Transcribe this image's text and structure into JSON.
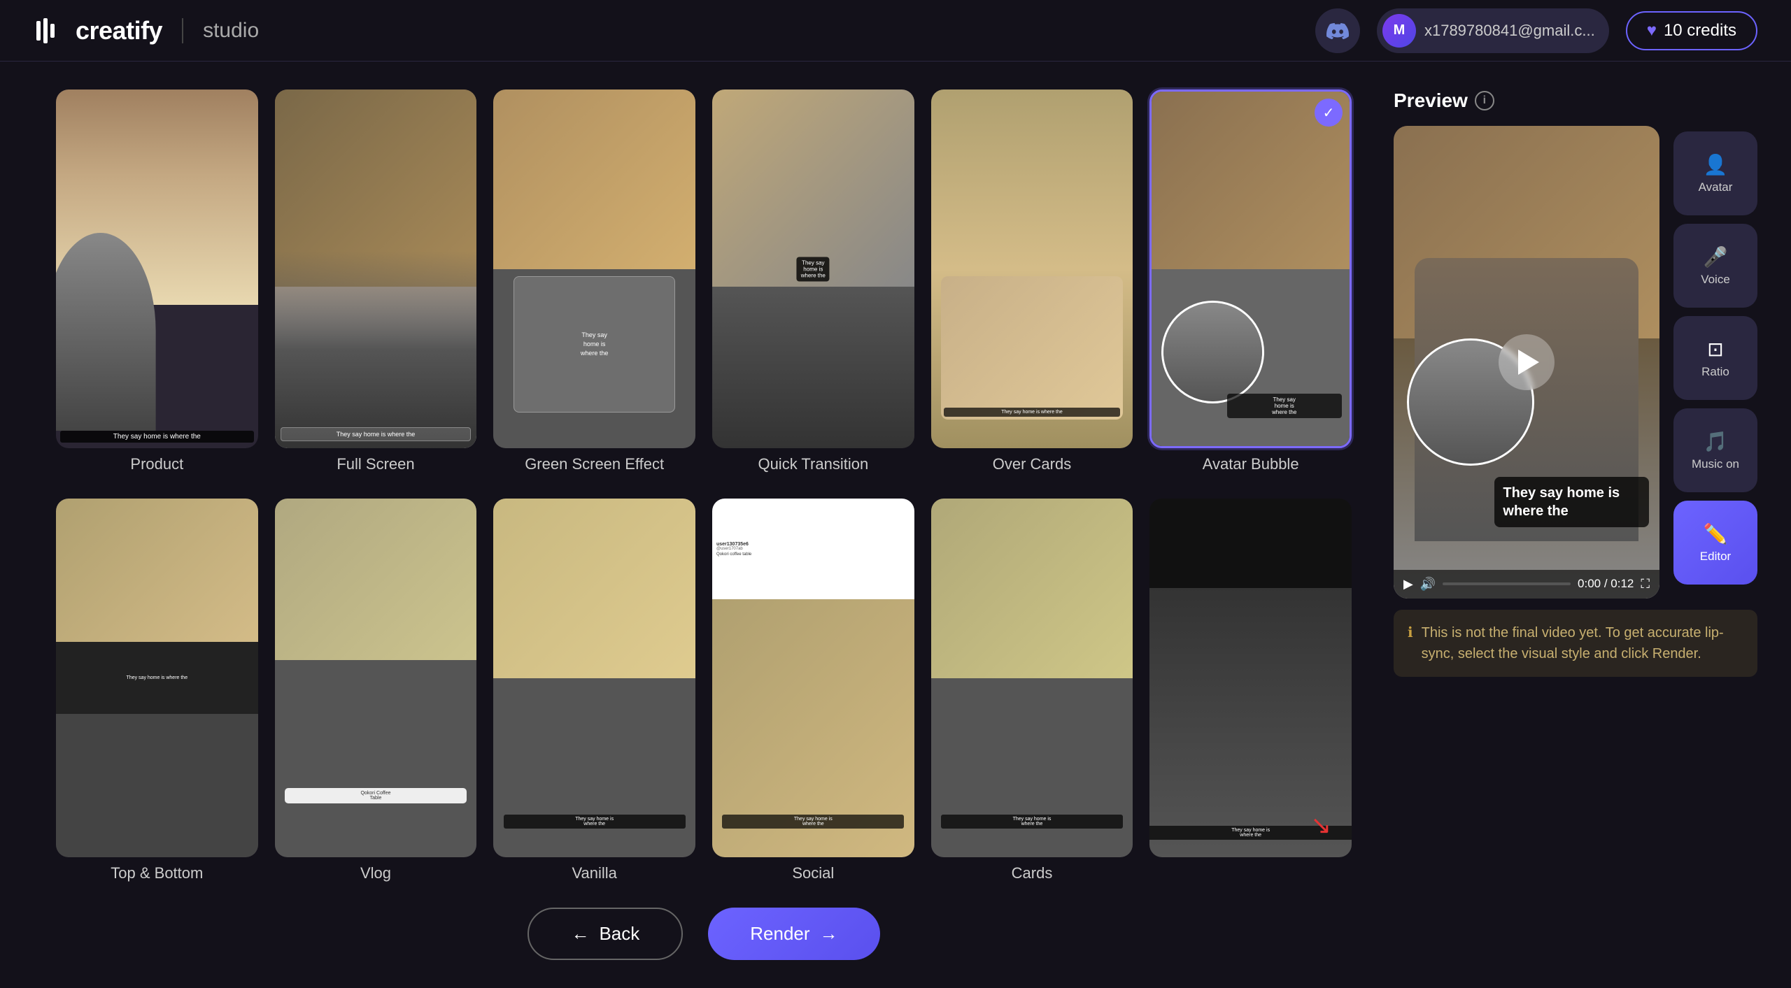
{
  "header": {
    "logo": "creatify",
    "studio": "studio",
    "discord_label": "discord",
    "user_initial": "M",
    "user_email": "x1789780841@gmail.c...",
    "credits_label": "10 credits"
  },
  "preview": {
    "title": "Preview",
    "caption_text": "They say home is where the",
    "time_current": "0:00",
    "time_total": "0:12",
    "time_display": "0:00 / 0:12",
    "notice": "This is not the final video yet. To get accurate lip-sync, select the visual style and click Render."
  },
  "side_buttons": [
    {
      "id": "avatar",
      "label": "Avatar",
      "icon": "👤"
    },
    {
      "id": "voice",
      "label": "Voice",
      "icon": "🔊"
    },
    {
      "id": "ratio",
      "label": "Ratio",
      "icon": "⊡"
    },
    {
      "id": "music",
      "label": "Music on",
      "icon": "🎵"
    },
    {
      "id": "editor",
      "label": "Editor",
      "icon": "✏️"
    }
  ],
  "grid": {
    "row1": [
      {
        "id": "product",
        "label": "Product",
        "style": "product",
        "selected": false
      },
      {
        "id": "full-screen",
        "label": "Full Screen",
        "style": "full-screen",
        "selected": false
      },
      {
        "id": "green-screen",
        "label": "Green Screen Effect",
        "style": "green-screen",
        "selected": false
      },
      {
        "id": "quick-transition",
        "label": "Quick Transition",
        "style": "quick-transition",
        "selected": false
      },
      {
        "id": "over-cards",
        "label": "Over Cards",
        "style": "over-cards",
        "selected": false
      },
      {
        "id": "avatar-bubble",
        "label": "Avatar Bubble",
        "style": "avatar-bubble",
        "selected": true
      }
    ],
    "row2": [
      {
        "id": "top-bottom",
        "label": "Top & Bottom",
        "style": "top-bottom",
        "selected": false
      },
      {
        "id": "vlog",
        "label": "Vlog",
        "style": "vlog",
        "selected": false
      },
      {
        "id": "vanilla",
        "label": "Vanilla",
        "style": "vanilla",
        "selected": false
      },
      {
        "id": "social",
        "label": "Social",
        "style": "social",
        "selected": false
      },
      {
        "id": "cards2",
        "label": "Cards",
        "style": "cards2",
        "selected": false
      },
      {
        "id": "dark-video",
        "label": "",
        "style": "dark-video",
        "selected": false
      }
    ]
  },
  "buttons": {
    "back": "← Back",
    "render": "Render →"
  }
}
